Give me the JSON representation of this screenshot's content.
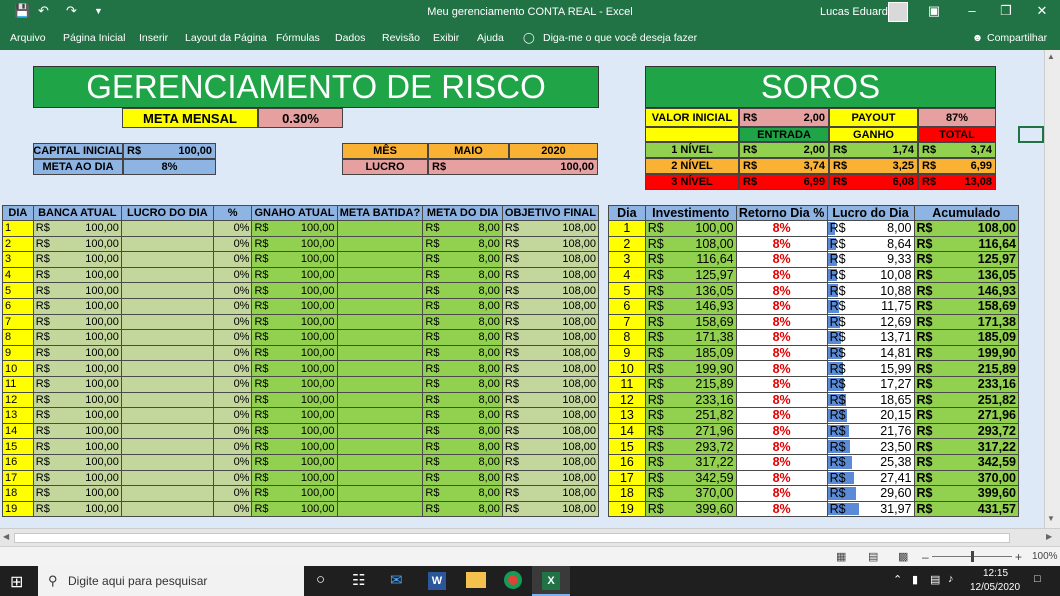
{
  "window": {
    "title": "Meu gerenciamento CONTA REAL  -  Excel",
    "user": "Lucas Eduardo"
  },
  "ribbon": {
    "tabs": [
      "Arquivo",
      "Página Inicial",
      "Inserir",
      "Layout da Página",
      "Fórmulas",
      "Dados",
      "Revisão",
      "Exibir",
      "Ajuda"
    ],
    "tell_me": "Diga-me o que você deseja fazer",
    "share": "Compartilhar"
  },
  "risk": {
    "title": "GERENCIAMENTO DE RISCO",
    "meta_mensal_label": "META MENSAL",
    "meta_mensal_value": "0.30%",
    "capital_inicial_label": "CAPITAL INICIAL",
    "capital_inicial_currency": "R$",
    "capital_inicial_value": "100,00",
    "meta_dia_label": "META AO DIA",
    "meta_dia_value": "8%",
    "mes_label": "MÊS",
    "mes_value": "MAIO",
    "ano_value": "2020",
    "lucro_label": "LUCRO",
    "lucro_currency": "R$",
    "lucro_value": "100,00"
  },
  "soros": {
    "title": "SOROS",
    "valor_inicial_label": "VALOR INICIAL",
    "valor_inicial_currency": "R$",
    "valor_inicial_value": "2,00",
    "payout_label": "PAYOUT",
    "payout_value": "87%",
    "entrada_label": "ENTRADA",
    "ganho_label": "GANHO",
    "total_label": "TOTAL",
    "levels": [
      {
        "label": "1 NÍVEL",
        "entrada": "2,00",
        "ganho": "1,74",
        "total": "3,74"
      },
      {
        "label": "2 NÍVEL",
        "entrada": "3,74",
        "ganho": "3,25",
        "total": "6,99"
      },
      {
        "label": "3 NÍVEL",
        "entrada": "6,99",
        "ganho": "6,08",
        "total": "13,08"
      }
    ]
  },
  "left_table": {
    "headers": [
      "DIA",
      "BANCA ATUAL",
      "LUCRO DO DIA",
      "%",
      "GNAHO ATUAL",
      "META BATIDA?",
      "META DO DIA",
      "OBJETIVO FINAL"
    ],
    "currency": "R$",
    "banca": "100,00",
    "pct": "0%",
    "ganho": "100,00",
    "meta": "8,00",
    "objetivo": "108,00",
    "days": [
      "1",
      "2",
      "3",
      "4",
      "5",
      "6",
      "7",
      "8",
      "9",
      "10",
      "11",
      "12",
      "13",
      "14",
      "15",
      "16",
      "17",
      "18",
      "19"
    ]
  },
  "right_table": {
    "headers": [
      "Dia",
      "Investimento",
      "Retorno Dia %",
      "Lucro do Dia",
      "Acumulado"
    ],
    "currency": "R$",
    "retorno": "8%",
    "rows": [
      {
        "dia": "1",
        "inv": "100,00",
        "lucro": "8,00",
        "acum": "108,00"
      },
      {
        "dia": "2",
        "inv": "108,00",
        "lucro": "8,64",
        "acum": "116,64"
      },
      {
        "dia": "3",
        "inv": "116,64",
        "lucro": "9,33",
        "acum": "125,97"
      },
      {
        "dia": "4",
        "inv": "125,97",
        "lucro": "10,08",
        "acum": "136,05"
      },
      {
        "dia": "5",
        "inv": "136,05",
        "lucro": "10,88",
        "acum": "146,93"
      },
      {
        "dia": "6",
        "inv": "146,93",
        "lucro": "11,75",
        "acum": "158,69"
      },
      {
        "dia": "7",
        "inv": "158,69",
        "lucro": "12,69",
        "acum": "171,38"
      },
      {
        "dia": "8",
        "inv": "171,38",
        "lucro": "13,71",
        "acum": "185,09"
      },
      {
        "dia": "9",
        "inv": "185,09",
        "lucro": "14,81",
        "acum": "199,90"
      },
      {
        "dia": "10",
        "inv": "199,90",
        "lucro": "15,99",
        "acum": "215,89"
      },
      {
        "dia": "11",
        "inv": "215,89",
        "lucro": "17,27",
        "acum": "233,16"
      },
      {
        "dia": "12",
        "inv": "233,16",
        "lucro": "18,65",
        "acum": "251,82"
      },
      {
        "dia": "13",
        "inv": "251,82",
        "lucro": "20,15",
        "acum": "271,96"
      },
      {
        "dia": "14",
        "inv": "271,96",
        "lucro": "21,76",
        "acum": "293,72"
      },
      {
        "dia": "15",
        "inv": "293,72",
        "lucro": "23,50",
        "acum": "317,22"
      },
      {
        "dia": "16",
        "inv": "317,22",
        "lucro": "25,38",
        "acum": "342,59"
      },
      {
        "dia": "17",
        "inv": "342,59",
        "lucro": "27,41",
        "acum": "370,00"
      },
      {
        "dia": "18",
        "inv": "370,00",
        "lucro": "29,60",
        "acum": "399,60"
      },
      {
        "dia": "19",
        "inv": "399,60",
        "lucro": "31,97",
        "acum": "431,57"
      }
    ]
  },
  "status": {
    "zoom": "100%"
  },
  "taskbar": {
    "search_placeholder": "Digite aqui para pesquisar",
    "time": "12:15",
    "date": "12/05/2020"
  },
  "colors": {
    "excel_green": "#217346",
    "header_blue": "#8eb4e3",
    "yellow": "#ffff00",
    "light_green": "#c3d69b",
    "salmon": "#e6a0a0",
    "orange": "#f9b233",
    "red": "#ff0000"
  }
}
